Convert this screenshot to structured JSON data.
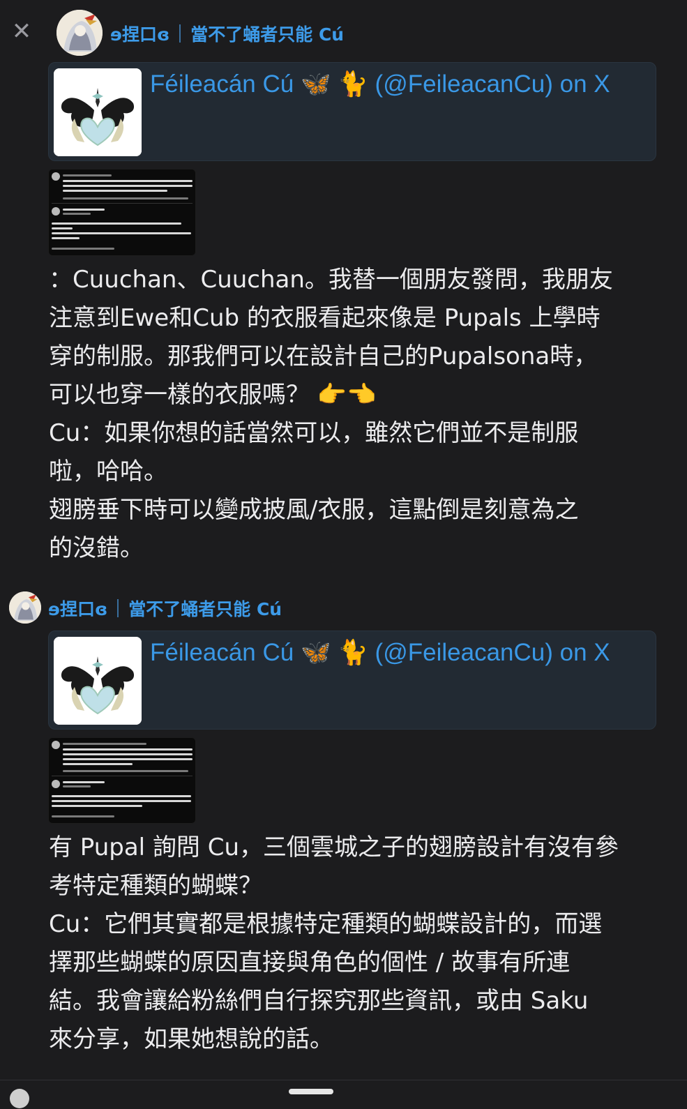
{
  "close_icon": "close-icon",
  "colors": {
    "background": "#1c1c1e",
    "author": "#3d9be9",
    "embed_bg": "#222a33",
    "embed_title": "#3a98e6",
    "text": "#ececee"
  },
  "posts": [
    {
      "author_name": "ɘ捏口ɞ",
      "author_status": "當不了蛹者只能 Cú",
      "embed_title": "Féileacán Cú 🦋 🐈 (@FeileacanCu) on X",
      "lines": [
        "：Cuuchan、Cuuchan。我替一個朋友發問，我朋友",
        "注意到Ewe和Cub 的衣服看起來像是 Pupals 上學時",
        "穿的制服。那我們可以在設計自己的Pupalsona時，",
        "可以也穿一樣的衣服嗎？ 👉👈",
        "Cu：如果你想的話當然可以，雖然它們並不是制服",
        "啦，哈哈。",
        "翅膀垂下時可以變成披風/衣服，這點倒是刻意為之",
        "的沒錯。"
      ]
    },
    {
      "author_name": "ɘ捏口ɞ",
      "author_status": "當不了蛹者只能 Cú",
      "embed_title": "Féileacán Cú 🦋 🐈 (@FeileacanCu) on X",
      "lines": [
        "有 Pupal 詢問 Cu，三個雲城之子的翅膀設計有沒有參",
        "考特定種類的蝴蝶？",
        "Cu：它們其實都是根據特定種類的蝴蝶設計的，而選",
        "擇那些蝴蝶的原因直接與角色的個性 / 故事有所連",
        "結。我會讓給粉絲們自行探究那些資訊，或由 Saku",
        "來分享，如果她想說的話。"
      ]
    }
  ]
}
